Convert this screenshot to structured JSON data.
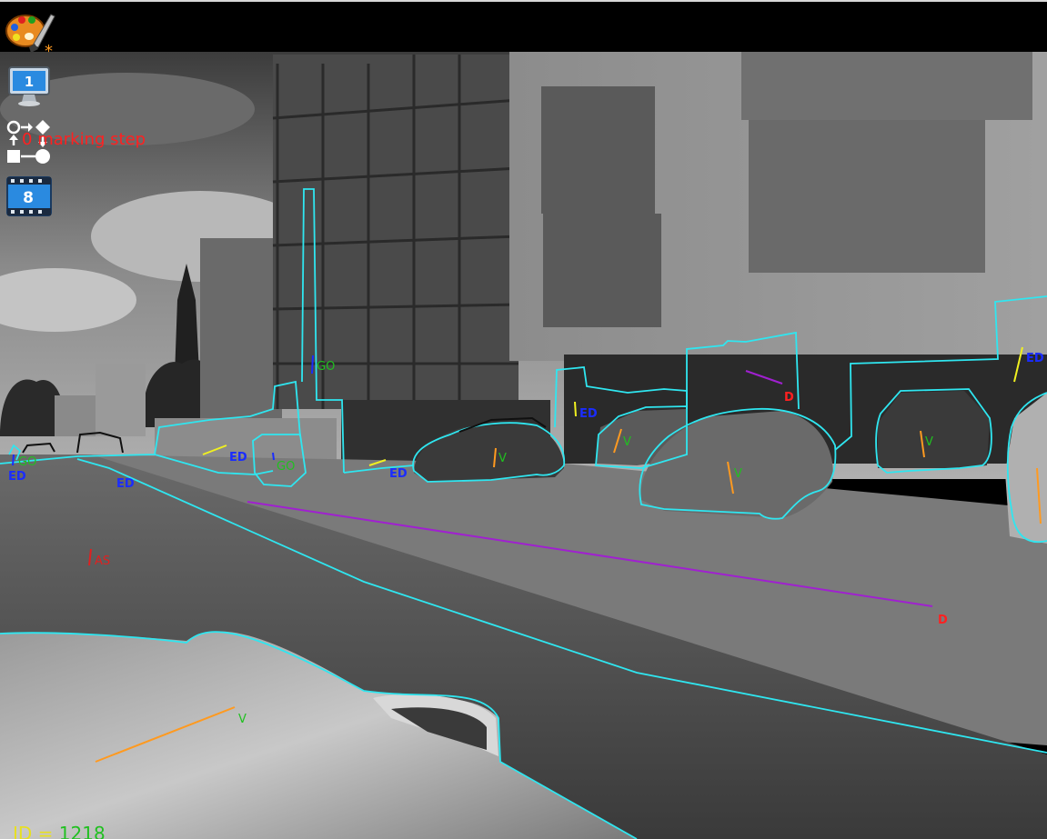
{
  "toolbar": {
    "paint_icon": "palette-icon",
    "modified_marker": "*",
    "monitor_icon": "monitor-icon",
    "monitor_number": "1",
    "step_counter": "0",
    "step_label": "marking step",
    "film_icon": "film-icon",
    "film_number": "8"
  },
  "status": {
    "id_key": "ID",
    "id_eq": " = ",
    "id_value": "1218"
  },
  "labels": {
    "go_top": "GO",
    "go_bin": "GO",
    "go_left": "GO",
    "ed_left": "ED",
    "ed_curb": "ED",
    "ed_fence": "ED",
    "ed_wall": "ED",
    "ed_gate": "ED",
    "ed_right": "ED",
    "v_car1": "V",
    "v_car2": "V",
    "v_car3": "V",
    "v_car4": "V",
    "v_hood": "V",
    "d_pole": "D",
    "d_line": "D",
    "as_mark": "AS"
  },
  "colors": {
    "outline": "#2fe6f0",
    "ed": "#1a2cff",
    "go": "#20c020",
    "v": "#20c020",
    "d": "#ff2020",
    "as": "#e02020",
    "orange": "#ff9a20",
    "yellow": "#f0f020",
    "purple": "#a020d0"
  }
}
